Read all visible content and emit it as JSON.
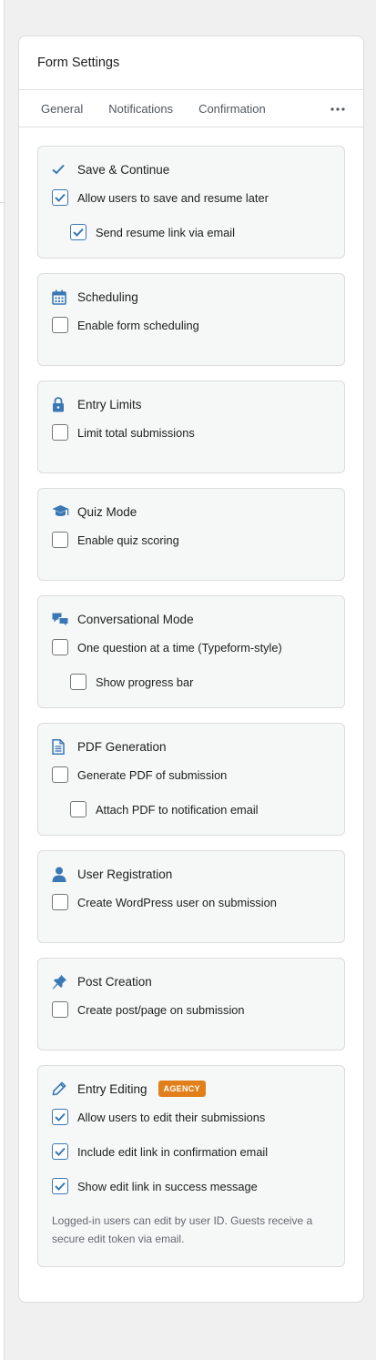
{
  "panel": {
    "title": "Form Settings"
  },
  "tabs": [
    {
      "label": "General"
    },
    {
      "label": "Notifications"
    },
    {
      "label": "Confirmation"
    }
  ],
  "more_icon": "ellipsis-icon",
  "accent_color": "#3a78b5",
  "badge_color": "#e1801b",
  "cards": [
    {
      "title": "Save & Continue",
      "icon": "checkmark-icon",
      "options": [
        {
          "label": "Allow users to save and resume later",
          "checked": true
        },
        {
          "label": "Send resume link via email",
          "checked": true
        }
      ]
    },
    {
      "title": "Scheduling",
      "icon": "calendar-icon",
      "options": [
        {
          "label": "Enable form scheduling",
          "checked": false
        }
      ]
    },
    {
      "title": "Entry Limits",
      "icon": "lock-icon",
      "options": [
        {
          "label": "Limit total submissions",
          "checked": false
        }
      ]
    },
    {
      "title": "Quiz Mode",
      "icon": "graduation-cap-icon",
      "options": [
        {
          "label": "Enable quiz scoring",
          "checked": false
        }
      ]
    },
    {
      "title": "Conversational Mode",
      "icon": "chat-bubbles-icon",
      "options": [
        {
          "label": "One question at a time (Typeform-style)",
          "checked": false
        },
        {
          "label": "Show progress bar",
          "checked": false
        }
      ]
    },
    {
      "title": "PDF Generation",
      "icon": "document-icon",
      "options": [
        {
          "label": "Generate PDF of submission",
          "checked": false
        },
        {
          "label": "Attach PDF to notification email",
          "checked": false
        }
      ]
    },
    {
      "title": "User Registration",
      "icon": "user-icon",
      "options": [
        {
          "label": "Create WordPress user on submission",
          "checked": false
        }
      ]
    },
    {
      "title": "Post Creation",
      "icon": "pin-icon",
      "options": [
        {
          "label": "Create post/page on submission",
          "checked": false
        }
      ]
    },
    {
      "title": "Entry Editing",
      "icon": "pencil-icon",
      "badge": "AGENCY",
      "options": [
        {
          "label": "Allow users to edit their submissions",
          "checked": true
        },
        {
          "label": "Include edit link in confirmation email",
          "checked": true
        },
        {
          "label": "Show edit link in success message",
          "checked": true
        }
      ],
      "note": "Logged-in users can edit by user ID. Guests receive a secure edit token via email."
    }
  ]
}
